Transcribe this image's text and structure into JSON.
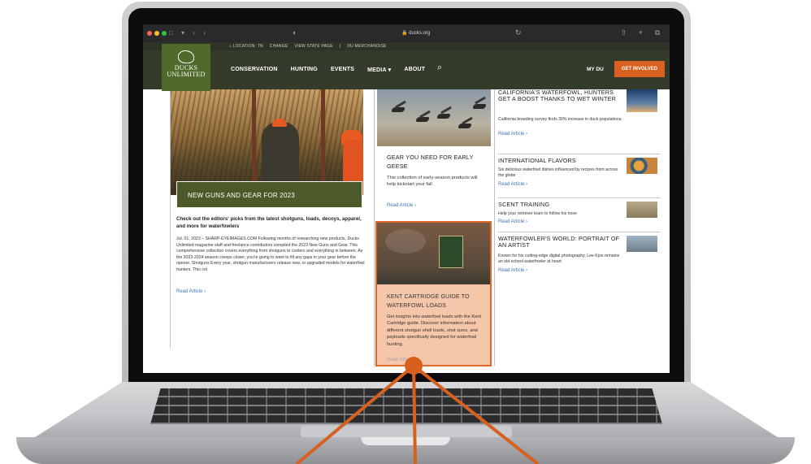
{
  "browser": {
    "url": "ducks.org",
    "traffic_lights": [
      "#ff5f57",
      "#febc2e",
      "#28c840"
    ],
    "nav_icons": "□ ▾ ‹ ›",
    "right_icons": "⇧ + ⧉",
    "shield_icon": "◐",
    "reload_icon": "↻"
  },
  "utility_bar": {
    "location": "LOCATION: TN",
    "change": "CHANGE",
    "view_state_page": "VIEW STATE PAGE",
    "separator": "|",
    "merchandise": "DU MERCHANDISE"
  },
  "logo": {
    "line1": "DUCKS",
    "line2": "UNLIMITED"
  },
  "nav": {
    "items": [
      "CONSERVATION",
      "HUNTING",
      "EVENTS",
      "MEDIA ▾",
      "ABOUT"
    ],
    "search_icon": "⌕",
    "my_du": "MY DU",
    "get_involved": "GET INVOLVED"
  },
  "main_article": {
    "title": "NEW GUNS AND GEAR FOR 2023",
    "lead": "Check out the editors' picks from the latest shotguns, loads, decoys, apparel, and more for waterfowlers",
    "body": "Jul. 01, 2023 – SHARP-EYEIMAGES.COM Following months of researching new products, Ducks Unlimited magazine staff and freelance contributors compiled the 2023 New Guns and Gear. This comprehensive collection covers everything from shotguns to coolers and everything in between. As the 2023-2024 season creeps closer, you're going to want to fill any gaps in your gear before the opener.  Shotguns Every year, shotgun manufacturers release new, or upgraded models for waterfowl hunters. This col",
    "read": "Read Article ›"
  },
  "gear_article": {
    "title": "GEAR YOU NEED FOR EARLY GEESE",
    "body": "This collection of early-season products will help kickstart your fall",
    "read": "Read Article ›"
  },
  "kent_article": {
    "title": "KENT CARTRIDGE GUIDE TO WATERFOWL LOADS",
    "body": "Get insights into waterfowl loads with the Kent Cartridge guide. Discover information about different shotgun shell loads, shot sizes, and payloads specifically designed for waterfowl hunting.",
    "read": "Read Article ›",
    "highlight_color": "#e2682a"
  },
  "side_articles": [
    {
      "title": "CALIFORNIA'S WATERFOWL, HUNTERS GET A BOOST THANKS TO WET WINTER",
      "desc": "California breeding survey finds 30% increase in duck populations.",
      "read": "Read Article ›"
    },
    {
      "title": "INTERNATIONAL FLAVORS",
      "desc": "Six delicious waterfowl dishes influenced by recipes from across the globe",
      "read": "Read Article ›"
    },
    {
      "title": "SCENT TRAINING",
      "desc": "Help your retriever learn to follow his nose",
      "read": "Read Article ›"
    },
    {
      "title": "WATERFOWLER'S WORLD: PORTRAIT OF AN ARTIST",
      "desc": "Known for his cutting-edge digital photography, Lee Kjos remains an old-school waterfowler at heart",
      "read": "Read Article ›"
    }
  ],
  "colors": {
    "nav_bg": "#343b2b",
    "logo_bg": "#4f6a2b",
    "cta": "#d9601f",
    "link": "#3e74b8",
    "callout": "#d8601f"
  }
}
